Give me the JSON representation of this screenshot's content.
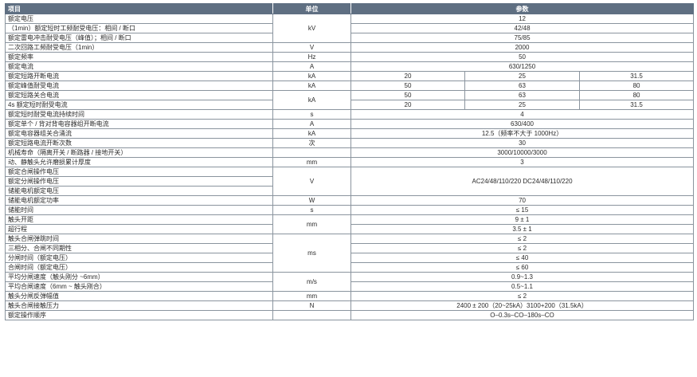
{
  "header": {
    "item": "项目",
    "unit": "单位",
    "param": "参数"
  },
  "rows": {
    "r01": {
      "item": "额定电压",
      "unit": "kV",
      "val": "12"
    },
    "r02": {
      "item": "（1min）额定短时工频耐受电压：相间 / 断口",
      "val": "42/48"
    },
    "r03": {
      "item": "额定雷电冲击耐受电压（峰值）；相间 / 断口",
      "val": "75/85"
    },
    "r04": {
      "item": "二次回路工频耐受电压（1min）",
      "unit": "V",
      "val": "2000"
    },
    "r05": {
      "item": "额定频率",
      "unit": "Hz",
      "val": "50"
    },
    "r06": {
      "item": "额定电流",
      "unit": "A",
      "val": "630/1250"
    },
    "r07": {
      "item": "额定短路开断电流",
      "unit": "kA",
      "v1": "20",
      "v2": "25",
      "v3": "31.5"
    },
    "r08": {
      "item": "额定峰值耐受电流",
      "unit": "kA",
      "v1": "50",
      "v2": "63",
      "v3": "80"
    },
    "r09": {
      "item": "额定短路关合电流",
      "unit": "kA",
      "v1": "50",
      "v2": "63",
      "v3": "80"
    },
    "r10": {
      "item": "4s 额定短时耐受电流",
      "v1": "20",
      "v2": "25",
      "v3": "31.5"
    },
    "r11": {
      "item": "额定短时耐受电流持续时间",
      "unit": "s",
      "val": "4"
    },
    "r12": {
      "item": "额定单个 / 背对背电容器组开断电流",
      "unit": "A",
      "val": "630/400"
    },
    "r13": {
      "item": "额定电容器组关合涌流",
      "unit": "kA",
      "val": "12.5（频率不大于 1000Hz）"
    },
    "r14": {
      "item": "额定短路电流开断次数",
      "unit": "次",
      "val": "30"
    },
    "r15": {
      "item": "机械寿命（隔离开关 / 断路器 / 接地开关）",
      "val": "3000/10000/3000"
    },
    "r16": {
      "item": "动、静触头允许磨损累计厚度",
      "unit": "mm",
      "val": "3"
    },
    "r17": {
      "item": "额定合闸操作电压",
      "unit": "V",
      "val": "AC24/48/110/220 DC24/48/110/220"
    },
    "r18": {
      "item": "额定分闸操作电压"
    },
    "r19": {
      "item": "储能电机额定电压"
    },
    "r20": {
      "item": "储能电机额定功率",
      "unit": "W",
      "val": "70"
    },
    "r21": {
      "item": "储能时间",
      "unit": "s",
      "val": "≤ 15"
    },
    "r22": {
      "item": "触头开距",
      "unit": "mm",
      "val": "9 ± 1"
    },
    "r23": {
      "item": "超行程",
      "val": "3.5 ± 1"
    },
    "r24": {
      "item": "触头合闸弹跳时间",
      "unit": "ms",
      "val": "≤ 2"
    },
    "r25": {
      "item": "三相分、合闸不同期性",
      "val": "≤ 2"
    },
    "r26": {
      "item": "分闸时间（额定电压）",
      "val": "≤ 40"
    },
    "r27": {
      "item": "合闸时间（额定电压）",
      "val": "≤ 60"
    },
    "r28": {
      "item": "平均分闸速度（触头刚分 ~6mm）",
      "unit": "m/s",
      "val": "0.9~1.3"
    },
    "r29": {
      "item": "平均合闸速度（6mm ~ 触头刚合）",
      "val": "0.5~1.1"
    },
    "r30": {
      "item": "触头分闸反弹幅值",
      "unit": "mm",
      "val": "≤ 2"
    },
    "r31": {
      "item": "触头合闸接触压力",
      "unit": "N",
      "val": "2400 ± 200（20~25kA）3100+200（31.5kA）"
    },
    "r32": {
      "item": "额定操作顺序",
      "val": "O–0.3s–CO–180s–CO"
    }
  }
}
